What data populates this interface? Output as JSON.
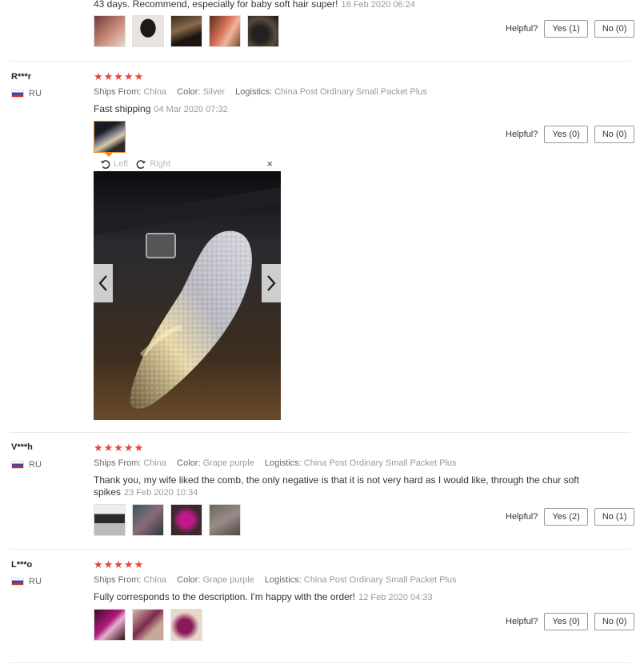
{
  "reviews": [
    {
      "text": "43 days. Recommend, especially for baby soft hair super!",
      "date": "18 Feb 2020 06:24",
      "helpful_label": "Helpful?",
      "yes": "Yes (1)",
      "no": "No (0)",
      "photos": [
        "photo-1",
        "photo-2",
        "photo-3",
        "photo-4",
        "photo-5"
      ]
    },
    {
      "user": "R***r",
      "country": "RU",
      "stars": "★★★★★",
      "ships_label": "Ships From:",
      "ships": "China",
      "color_label": "Color:",
      "color": "Silver",
      "logistics_label": "Logistics:",
      "logistics": "China Post Ordinary Small Packet Plus",
      "text": "Fast shipping",
      "date": "04 Mar 2020 07:32",
      "helpful_label": "Helpful?",
      "yes": "Yes (0)",
      "no": "No (0)",
      "viewer": {
        "left": "Left",
        "right": "Right",
        "close": "×"
      }
    },
    {
      "user": "V***h",
      "country": "RU",
      "stars": "★★★★★",
      "ships_label": "Ships From:",
      "ships": "China",
      "color_label": "Color:",
      "color": "Grape purple",
      "logistics_label": "Logistics:",
      "logistics": "China Post Ordinary Small Packet Plus",
      "text_line1": "Thank you, my wife liked the comb, the only negative is that it is not very hard as I would like, through the chur soft",
      "text_line2": "spikes",
      "date": "23 Feb 2020 10:34",
      "helpful_label": "Helpful?",
      "yes": "Yes (2)",
      "no": "No (1)"
    },
    {
      "user": "L***o",
      "country": "RU",
      "stars": "★★★★★",
      "ships_label": "Ships From:",
      "ships": "China",
      "color_label": "Color:",
      "color": "Grape purple",
      "logistics_label": "Logistics:",
      "logistics": "China Post Ordinary Small Packet Plus",
      "text": "Fully corresponds to the description. I'm happy with the order!",
      "date": "12 Feb 2020 04:33",
      "helpful_label": "Helpful?",
      "yes": "Yes (0)",
      "no": "No (0)"
    }
  ],
  "colors": {
    "star": "#e8443a",
    "active_thumb": "#f08a24"
  }
}
